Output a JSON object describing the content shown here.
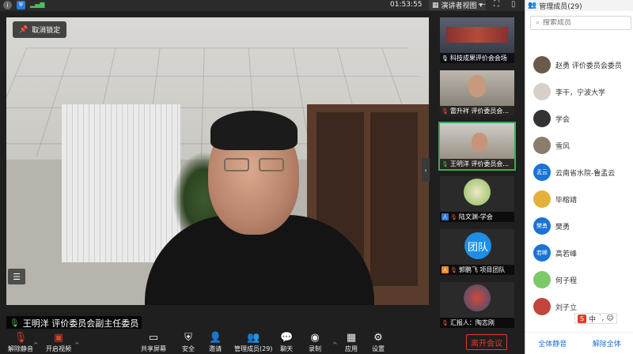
{
  "topbar": {
    "time": "01:53:55",
    "view_label": "演讲者视图",
    "view_caret": "▾"
  },
  "main_video": {
    "unpin_label": "取消锁定",
    "speaker_name": "王明洋 评价委员会副主任委员"
  },
  "thumbnails": [
    {
      "caption": "科技成果评价会会场"
    },
    {
      "caption": "雷升祥 评价委员会..."
    },
    {
      "caption": "王明洋 评价委员会..."
    },
    {
      "caption": "陆文渊-学会"
    },
    {
      "caption": "郭鹏飞 项目团队",
      "badge": "团队"
    },
    {
      "caption": "汇报人：陶志刚"
    }
  ],
  "panel": {
    "title": "管理成员(29)",
    "search_placeholder": "搜索成员",
    "members": [
      {
        "name": "赵勇 评价委员会委员",
        "avatar_color": "#6b5a4a"
      },
      {
        "name": "李干，宁波大学",
        "avatar_color": "#d8d0c8"
      },
      {
        "name": "学会",
        "avatar_color": "#333333"
      },
      {
        "name": "雪风",
        "avatar_color": "#8a7d6a"
      },
      {
        "name": "云南省水院-鲁孟云",
        "avatar_color": "#1a73d6",
        "avatar_text": "孟云"
      },
      {
        "name": "毕榕靖",
        "avatar_color": "#e2b23a"
      },
      {
        "name": "樊勇",
        "avatar_color": "#1a73d6",
        "avatar_text": "樊勇"
      },
      {
        "name": "高若峰",
        "avatar_color": "#1a73d6",
        "avatar_text": "若峰"
      },
      {
        "name": "何子程",
        "avatar_color": "#7bc96a"
      },
      {
        "name": "刘子立",
        "avatar_color": "#c2443a"
      }
    ],
    "mute_all": "全体静音",
    "unmute_all": "解除全体"
  },
  "ime": {
    "label": "中"
  },
  "toolbar": {
    "tools": [
      {
        "label": "解除静音",
        "icon": "mic-muted-icon"
      },
      {
        "label": "开启视频",
        "icon": "video-off-icon"
      },
      {
        "label": "共享屏幕",
        "icon": "share-screen-icon"
      },
      {
        "label": "安全",
        "icon": "shield-icon"
      },
      {
        "label": "邀请",
        "icon": "invite-icon"
      },
      {
        "label": "管理成员(29)",
        "icon": "members-icon"
      },
      {
        "label": "聊天",
        "icon": "chat-icon"
      },
      {
        "label": "录制",
        "icon": "record-icon"
      },
      {
        "label": "应用",
        "icon": "apps-icon"
      },
      {
        "label": "设置",
        "icon": "settings-icon"
      }
    ],
    "leave_label": "离开会议"
  }
}
